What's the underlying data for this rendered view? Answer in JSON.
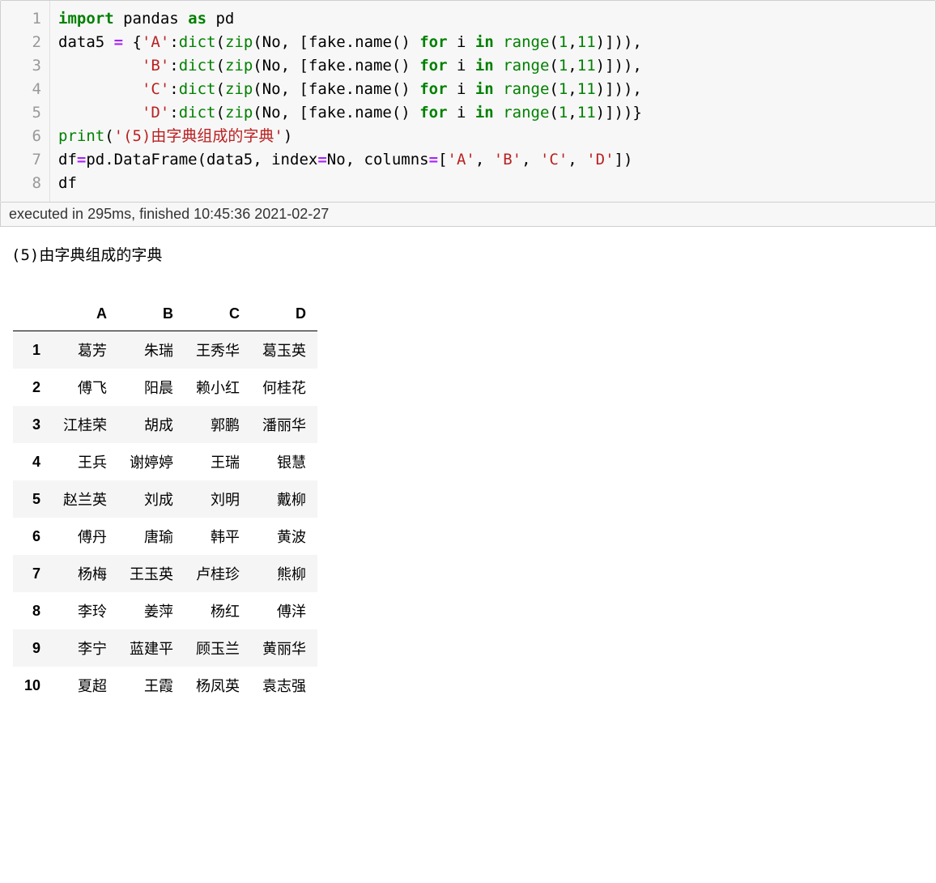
{
  "code": {
    "lines": [
      "1",
      "2",
      "3",
      "4",
      "5",
      "6",
      "7",
      "8"
    ],
    "l1": {
      "kw1": "import",
      "mod": " pandas ",
      "kw2": "as",
      "alias": " pd"
    },
    "l2": {
      "a": "data5 ",
      "eq": "=",
      "b": " {",
      "sA": "'A'",
      "c": ":",
      "dict": "dict",
      "d": "(",
      "zip": "zip",
      "e": "(No, [fake.name() ",
      "for": "for",
      "f": " i ",
      "in": "in",
      "g": " ",
      "range": "range",
      "h": "(",
      "n1": "1",
      "i": ",",
      "n11": "11",
      "j": ")])),"
    },
    "l3": {
      "pad": "         ",
      "sB": "'B'",
      "c": ":",
      "dict": "dict",
      "d": "(",
      "zip": "zip",
      "e": "(No, [fake.name() ",
      "for": "for",
      "f": " i ",
      "in": "in",
      "g": " ",
      "range": "range",
      "h": "(",
      "n1": "1",
      "i": ",",
      "n11": "11",
      "j": ")])),"
    },
    "l4": {
      "pad": "         ",
      "sC": "'C'",
      "c": ":",
      "dict": "dict",
      "d": "(",
      "zip": "zip",
      "e": "(No, [fake.name() ",
      "for": "for",
      "f": " i ",
      "in": "in",
      "g": " ",
      "range": "range",
      "h": "(",
      "n1": "1",
      "i": ",",
      "n11": "11",
      "j": ")])),"
    },
    "l5": {
      "pad": "         ",
      "sD": "'D'",
      "c": ":",
      "dict": "dict",
      "d": "(",
      "zip": "zip",
      "e": "(No, [fake.name() ",
      "for": "for",
      "f": " i ",
      "in": "in",
      "g": " ",
      "range": "range",
      "h": "(",
      "n1": "1",
      "i": ",",
      "n11": "11",
      "j": ")]))}"
    },
    "l6": {
      "print": "print",
      "a": "(",
      "s": "'(5)由字典组成的字典'",
      "b": ")"
    },
    "l7": {
      "a": "df",
      "eq": "=",
      "b": "pd.DataFrame(data5, index",
      "eq2": "=",
      "c": "No, columns",
      "eq3": "=",
      "d": "[",
      "sA": "'A'",
      "e": ", ",
      "sB": "'B'",
      "f": ", ",
      "sC": "'C'",
      "g": ", ",
      "sD": "'D'",
      "h": "])"
    },
    "l8": {
      "a": "df"
    }
  },
  "timing": "executed in 295ms, finished 10:45:36 2021-02-27",
  "output_text": "(5)由字典组成的字典",
  "table": {
    "columns": [
      "A",
      "B",
      "C",
      "D"
    ],
    "index": [
      "1",
      "2",
      "3",
      "4",
      "5",
      "6",
      "7",
      "8",
      "9",
      "10"
    ],
    "rows": [
      [
        "葛芳",
        "朱瑞",
        "王秀华",
        "葛玉英"
      ],
      [
        "傅飞",
        "阳晨",
        "赖小红",
        "何桂花"
      ],
      [
        "江桂荣",
        "胡成",
        "郭鹏",
        "潘丽华"
      ],
      [
        "王兵",
        "谢婷婷",
        "王瑞",
        "银慧"
      ],
      [
        "赵兰英",
        "刘成",
        "刘明",
        "戴柳"
      ],
      [
        "傅丹",
        "唐瑜",
        "韩平",
        "黄波"
      ],
      [
        "杨梅",
        "王玉英",
        "卢桂珍",
        "熊柳"
      ],
      [
        "李玲",
        "姜萍",
        "杨红",
        "傅洋"
      ],
      [
        "李宁",
        "蓝建平",
        "顾玉兰",
        "黄丽华"
      ],
      [
        "夏超",
        "王霞",
        "杨凤英",
        "袁志强"
      ]
    ]
  }
}
